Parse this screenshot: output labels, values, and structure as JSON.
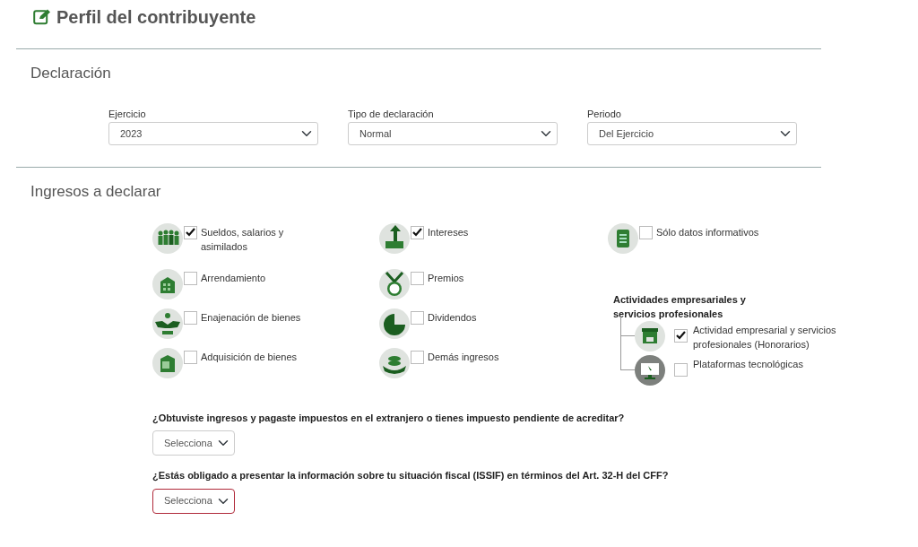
{
  "title": "Perfil del contribuyente",
  "declaracion": {
    "heading": "Declaración",
    "fields": [
      {
        "label": "Ejercicio",
        "value": "2023"
      },
      {
        "label": "Tipo de declaración",
        "value": "Normal"
      },
      {
        "label": "Periodo",
        "value": "Del Ejercicio"
      }
    ]
  },
  "ingresos": {
    "heading": "Ingresos a declarar",
    "columns": [
      [
        {
          "label": "Sueldos, salarios y asimilados",
          "checked": true
        },
        {
          "label": "Arrendamiento",
          "checked": false
        },
        {
          "label": "Enajenación de bienes",
          "checked": false
        },
        {
          "label": "Adquisición de bienes",
          "checked": false
        }
      ],
      [
        {
          "label": "Intereses",
          "checked": true
        },
        {
          "label": "Premios",
          "checked": false
        },
        {
          "label": "Dividendos",
          "checked": false
        },
        {
          "label": "Demás ingresos",
          "checked": false
        }
      ]
    ],
    "informative": {
      "label": "Sólo datos informativos",
      "checked": false
    },
    "activities": {
      "title": "Actividades empresariales y servicios profesionales",
      "items": [
        {
          "label": "Actividad empresarial y servicios profesionales (Honorarios)",
          "checked": true
        },
        {
          "label": "Plataformas tecnológicas",
          "checked": false
        }
      ]
    }
  },
  "questions": [
    {
      "text": "¿Obtuviste ingresos y pagaste impuestos en el extranjero o tienes impuesto pendiente de acreditar?",
      "value": "Selecciona",
      "invalid": false
    },
    {
      "text": "¿Estás obligado a presentar la información sobre tu situación fiscal (ISSIF) en términos del Art. 32-H del CFF?",
      "value": "Selecciona",
      "invalid": true
    }
  ]
}
